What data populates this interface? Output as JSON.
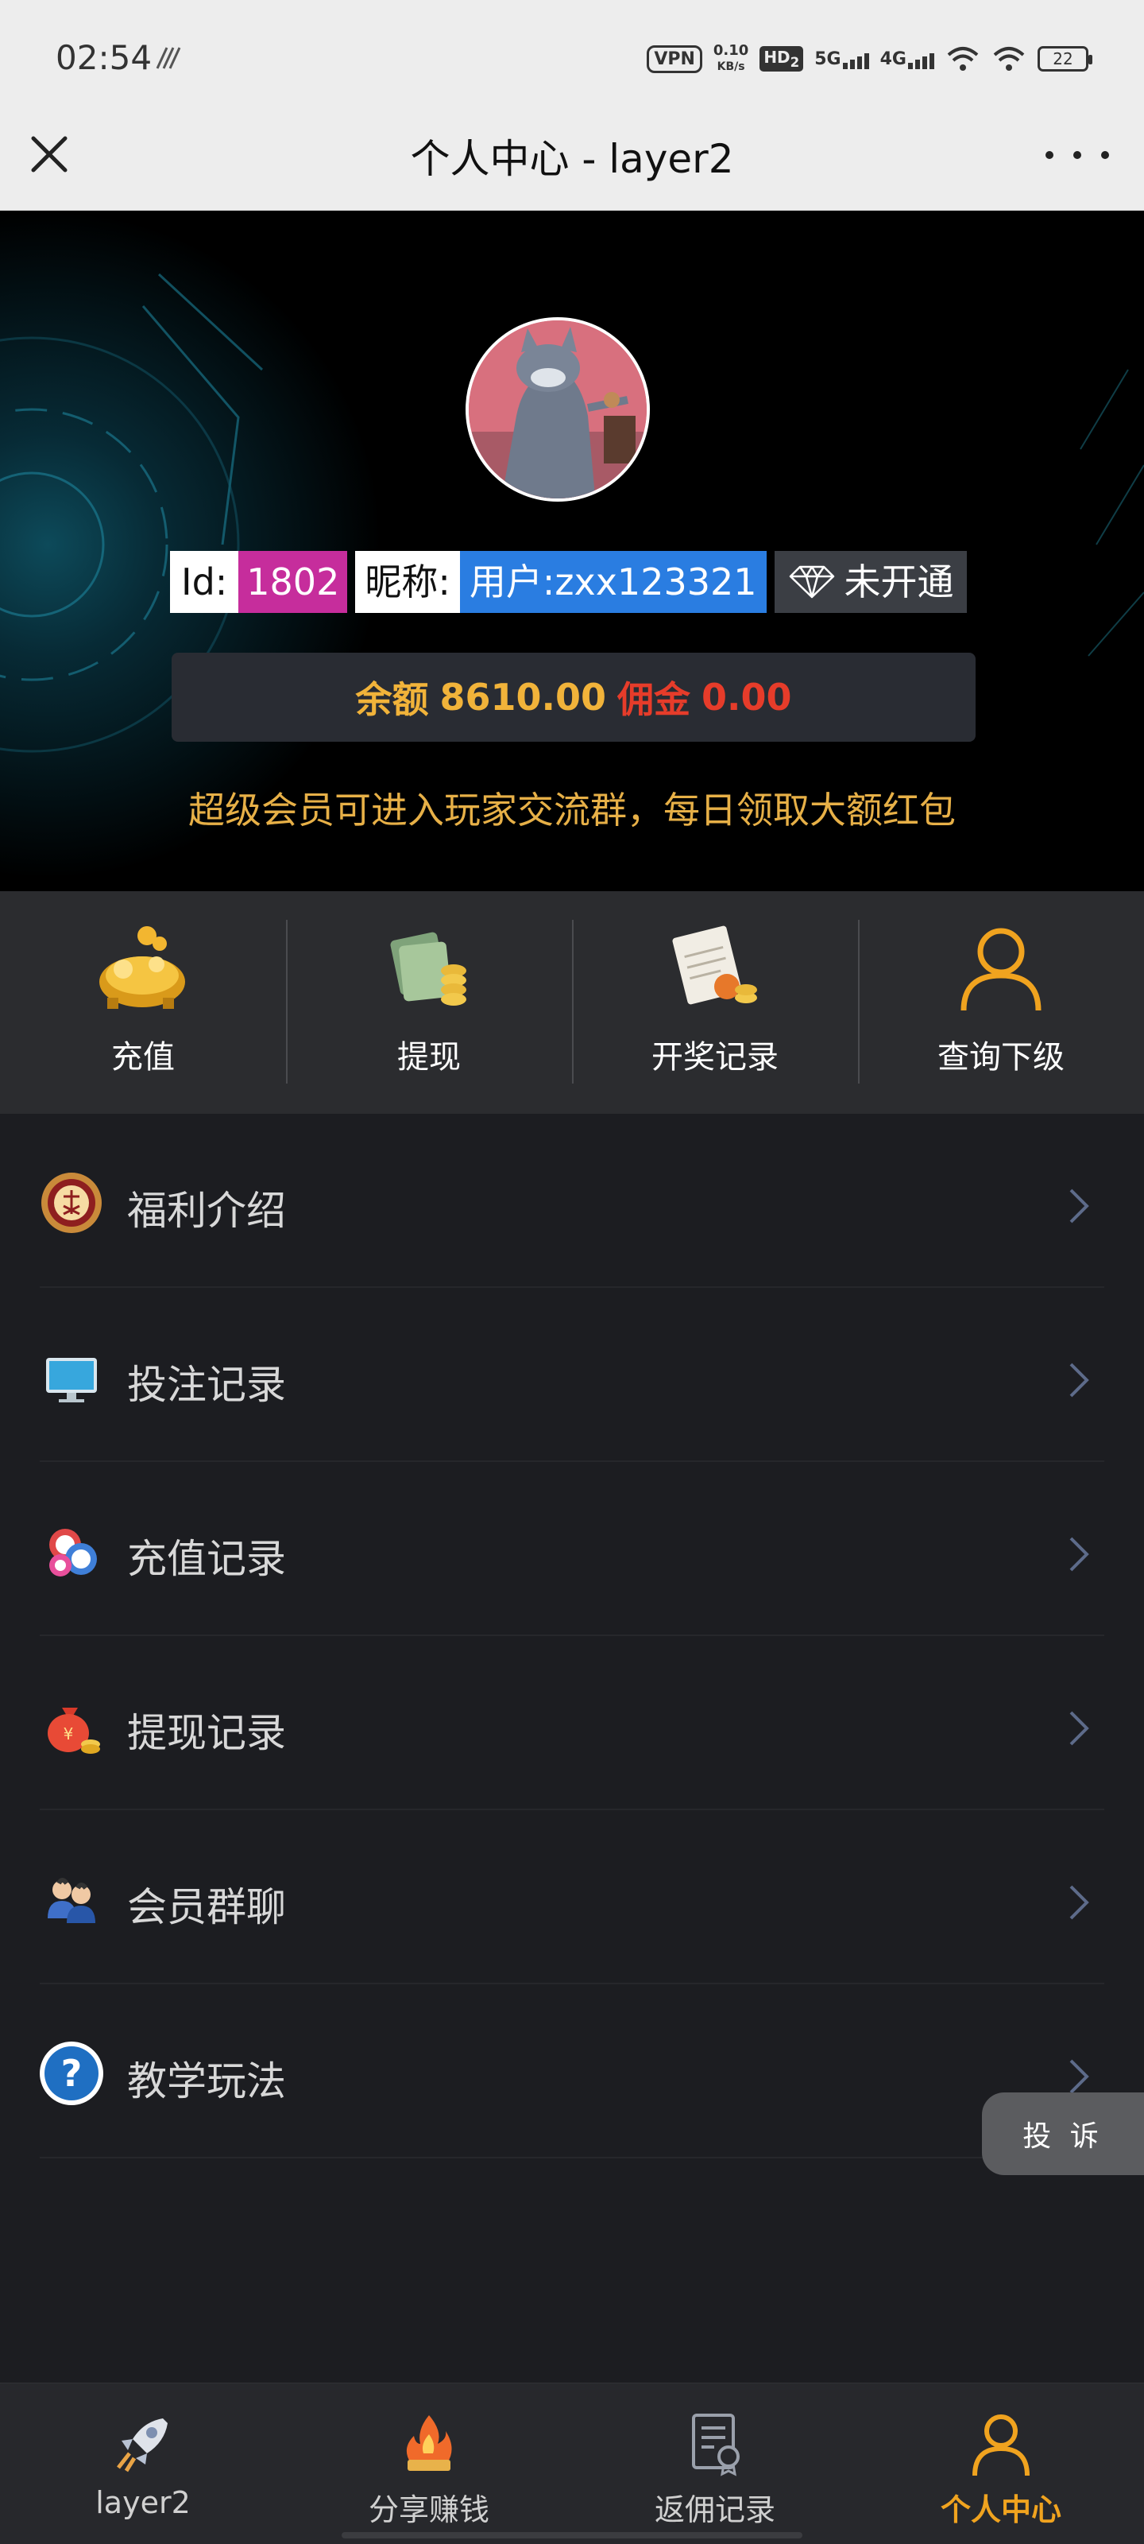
{
  "status_bar": {
    "time": "02:54",
    "vpn": "VPN",
    "speed_value": "0.10",
    "speed_unit": "KB/s",
    "hd": "HD",
    "hd_sub": "2",
    "net1": "5G",
    "net2": "4G",
    "battery": "22"
  },
  "title_bar": {
    "title": "个人中心 - layer2"
  },
  "profile": {
    "id_label": "Id:",
    "id_value": "1802",
    "nick_label": "昵称:",
    "nick_value": "用户:zxx123321",
    "vip_status": "未开通",
    "balance_label": "余额",
    "balance_value": "8610.00",
    "commission_label": "佣金",
    "commission_value": "0.00",
    "notice": "超级会员可进入玩家交流群，每日领取大额红包"
  },
  "quick_actions": [
    {
      "label": "充值",
      "icon": "piggy-bank-icon"
    },
    {
      "label": "提现",
      "icon": "cash-coins-icon"
    },
    {
      "label": "开奖记录",
      "icon": "order-record-icon"
    },
    {
      "label": "查询下级",
      "icon": "user-icon"
    }
  ],
  "menu": [
    {
      "label": "福利介绍",
      "icon": "award-medal-icon"
    },
    {
      "label": "投注记录",
      "icon": "monitor-icon"
    },
    {
      "label": "充值记录",
      "icon": "poker-chips-icon"
    },
    {
      "label": "提现记录",
      "icon": "money-bag-icon"
    },
    {
      "label": "会员群聊",
      "icon": "group-users-icon"
    },
    {
      "label": "教学玩法",
      "icon": "help-question-icon"
    }
  ],
  "complain_button": "投 诉",
  "tabbar": [
    {
      "label": "layer2",
      "icon": "rocket-icon",
      "active": false
    },
    {
      "label": "分享赚钱",
      "icon": "flame-gift-icon",
      "active": false
    },
    {
      "label": "返佣记录",
      "icon": "certificate-icon",
      "active": false
    },
    {
      "label": "个人中心",
      "icon": "user-icon",
      "active": true
    }
  ],
  "colors": {
    "accent": "#f0a31f",
    "background": "#1c1d21",
    "id_badge": "#c62d9c",
    "nick_badge": "#2a7de1",
    "balance": "#f1b33a",
    "commission": "#e63c2a"
  }
}
